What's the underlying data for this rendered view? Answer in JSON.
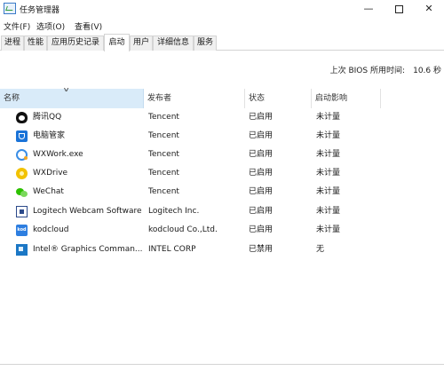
{
  "window": {
    "title": "任务管理器",
    "controls": {
      "minimize": "—",
      "maximize": "",
      "close": "✕"
    }
  },
  "menu": [
    "文件(F)",
    "选项(O)",
    "查看(V)"
  ],
  "tabs": [
    "进程",
    "性能",
    "应用历史记录",
    "启动",
    "用户",
    "详细信息",
    "服务"
  ],
  "active_tab": "启动",
  "bios": {
    "label": "上次 BIOS 所用时间:",
    "value": "10.6 秒"
  },
  "columns": [
    "名称",
    "发布者",
    "状态",
    "启动影响"
  ],
  "sorted_column": "名称",
  "rows": [
    {
      "icon": "qq-icon",
      "name": "腾讯QQ",
      "publisher": "Tencent",
      "status": "已启用",
      "impact": "未计量"
    },
    {
      "icon": "pc-manager-icon",
      "name": "电脑管家",
      "publisher": "Tencent",
      "status": "已启用",
      "impact": "未计量"
    },
    {
      "icon": "wxwork-icon",
      "name": "WXWork.exe",
      "publisher": "Tencent",
      "status": "已启用",
      "impact": "未计量"
    },
    {
      "icon": "wxdrive-icon",
      "name": "WXDrive",
      "publisher": "Tencent",
      "status": "已启用",
      "impact": "未计量"
    },
    {
      "icon": "wechat-icon",
      "name": "WeChat",
      "publisher": "Tencent",
      "status": "已启用",
      "impact": "未计量"
    },
    {
      "icon": "logitech-icon",
      "name": "Logitech Webcam Software",
      "publisher": "Logitech Inc.",
      "status": "已启用",
      "impact": "未计量"
    },
    {
      "icon": "kodcloud-icon",
      "name": "kodcloud",
      "publisher": "kodcloud Co.,Ltd.",
      "status": "已启用",
      "impact": "未计量"
    },
    {
      "icon": "intel-graphics-icon",
      "name": "Intel® Graphics Comman...",
      "publisher": "INTEL CORP",
      "status": "已禁用",
      "impact": "无"
    }
  ],
  "kodcloud_icon_text": "kod",
  "colors": {
    "sorted_header": "#d9ebf9",
    "accent": "#1a73d8"
  }
}
